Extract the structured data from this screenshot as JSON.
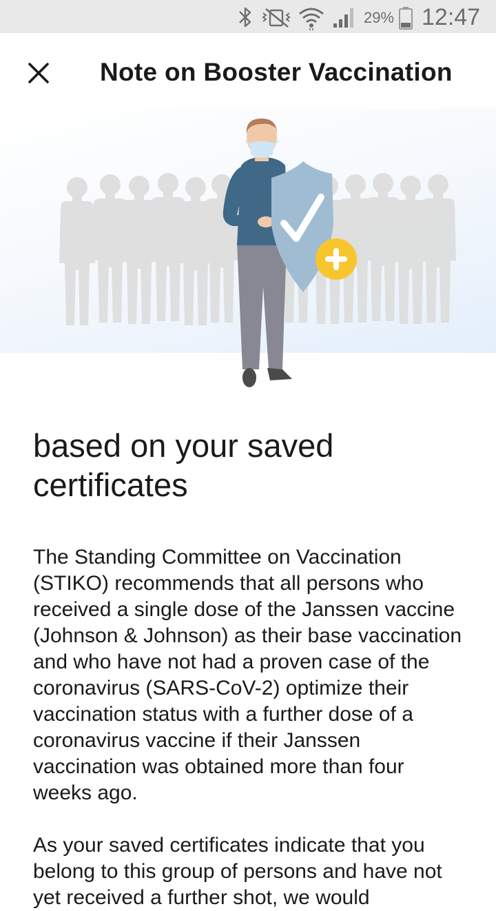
{
  "status_bar": {
    "battery_percent": "29%",
    "time": "12:47",
    "icons": [
      "bluetooth-icon",
      "vibrate-off-icon",
      "wifi-icon",
      "cellular-signal-icon",
      "battery-icon"
    ]
  },
  "header": {
    "title": "Note on Booster Vaccination",
    "close_icon": "close-icon"
  },
  "hero": {
    "illustration": "person-with-shield-illustration",
    "colors": {
      "shield": "#9fbcd2",
      "plus_badge": "#f7c62f",
      "shirt": "#3f6987",
      "pants": "#878893",
      "crowd": "#dedede"
    }
  },
  "content": {
    "subtitle": "based on your saved certificates",
    "paragraph_1": "The Standing Committee on Vaccination (STIKO) recommends that all persons who received a single dose of the Janssen vaccine (Johnson & Johnson) as their base vaccination and who have not had a proven case of the coronavirus (SARS-CoV-2) optimize their vaccination status with a further dose of a coronavirus vaccine if their Janssen vaccination was obtained more than four weeks ago.",
    "paragraph_2": "As your saved certificates indicate that you belong to this group of persons and have not yet received a further shot, we would"
  }
}
